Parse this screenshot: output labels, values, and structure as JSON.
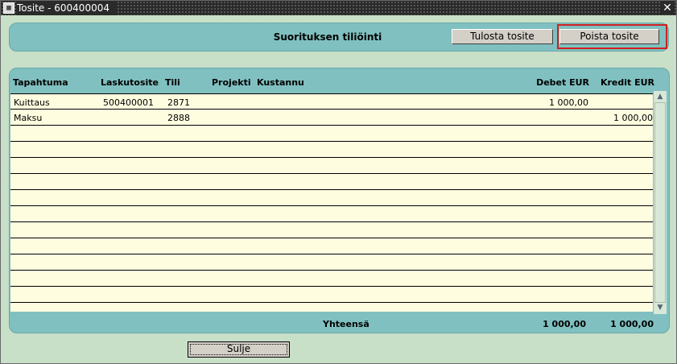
{
  "window": {
    "title": "Tosite - 600400004",
    "close_glyph": "✕"
  },
  "topbar": {
    "heading": "Suorituksen tiliöinti",
    "print_label": "Tulosta tosite",
    "delete_label": "Poista tosite"
  },
  "table": {
    "columns": [
      "Tapahtuma",
      "Laskutosite",
      "Tili",
      "Projekti",
      "Kustannu",
      "Debet EUR",
      "Kredit EUR"
    ],
    "rows": [
      [
        "Kuittaus",
        "500400001",
        "2871",
        "",
        "",
        "1 000,00",
        ""
      ],
      [
        "Maksu",
        "",
        "2888",
        "",
        "",
        "",
        "1 000,00"
      ]
    ],
    "total_label": "Yhteensä",
    "total_debet": "1 000,00",
    "total_kredit": "1 000,00"
  },
  "footer": {
    "close_label": "Sulje"
  },
  "colors": {
    "background": "#c8dfc8",
    "panel": "#80c0c0",
    "grid": "#fffde0",
    "highlight": "#d02020"
  }
}
